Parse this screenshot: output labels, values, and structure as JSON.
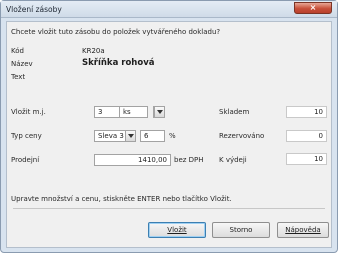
{
  "window": {
    "title": "Vložení zásoby",
    "close_glyph": "×"
  },
  "question": "Chcete vložit tuto zásobu do položek vytvářeného dokladu?",
  "info": {
    "code_label": "Kód",
    "code_value": "KR20a",
    "name_label": "Název",
    "name_value": "Skříňka rohová",
    "text_label": "Text"
  },
  "form": {
    "qty_label": "Vložit m.j.",
    "qty_value": "3",
    "unit_value": "ks",
    "price_type_label": "Typ ceny",
    "price_type_value": "Sleva 3",
    "discount_value": "6",
    "percent_sign": "%",
    "sale_label": "Prodejní",
    "sale_value": "1410,00",
    "sale_suffix": "bez DPH"
  },
  "stock": {
    "instock_label": "Skladem",
    "instock_value": "10",
    "reserved_label": "Rezervováno",
    "reserved_value": "0",
    "available_label": "K výdeji",
    "available_value": "10"
  },
  "hint": "Upravte množství a cenu, stiskněte ENTER nebo tlačítko Vložit.",
  "buttons": {
    "insert": "Vložit",
    "cancel": "Storno",
    "help": "Nápověda"
  },
  "colors": {
    "titlebar": "#d8e3ef",
    "close": "#c8503a",
    "default_border": "#3c7fb1"
  }
}
